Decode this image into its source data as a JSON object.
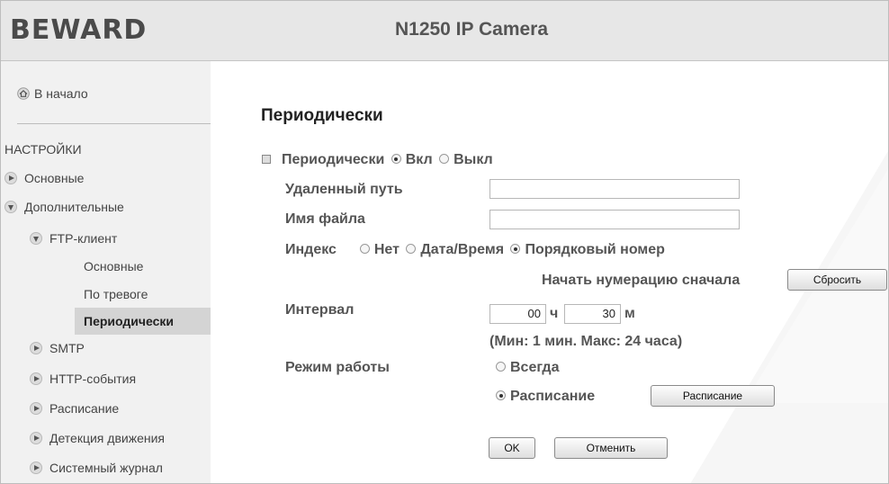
{
  "header": {
    "logo": "BEWARD",
    "camera_title": "N1250 IP Camera"
  },
  "sidebar": {
    "home_label": "В начало",
    "section_title": "НАСТРОЙКИ",
    "items": [
      {
        "label": "Основные",
        "state": "collapsed"
      },
      {
        "label": "Дополнительные",
        "state": "expanded"
      },
      {
        "label": "FTP-клиент",
        "state": "expanded"
      },
      {
        "label": "SMTP",
        "state": "collapsed"
      },
      {
        "label": "HTTP-события",
        "state": "collapsed"
      },
      {
        "label": "Расписание",
        "state": "collapsed"
      },
      {
        "label": "Детекция движения",
        "state": "collapsed"
      },
      {
        "label": "Системный журнал",
        "state": "collapsed"
      }
    ],
    "ftp_subitems": [
      {
        "label": "Основные",
        "active": false
      },
      {
        "label": "По тревоге",
        "active": false
      },
      {
        "label": "Периодически",
        "active": true
      }
    ]
  },
  "main": {
    "title": "Периодически",
    "periodic": {
      "label": "Периодически",
      "on_label": "Вкл",
      "off_label": "Выкл",
      "selected": "on"
    },
    "remote_path": {
      "label": "Удаленный путь",
      "value": ""
    },
    "file_name": {
      "label": "Имя файла",
      "value": ""
    },
    "index": {
      "label": "Индекс",
      "options": [
        "Нет",
        "Дата/Время",
        "Порядковый номер"
      ],
      "selected": "Порядковый номер"
    },
    "restart_numbering_label": "Начать нумерацию сначала",
    "reset_button": "Сбросить",
    "interval": {
      "label": "Интервал",
      "hours": "00",
      "hours_unit": "ч",
      "minutes": "30",
      "minutes_unit": "м"
    },
    "interval_hint": "(Мин: 1 мин. Макс: 24 часа)",
    "mode": {
      "label": "Режим работы",
      "always_label": "Всегда",
      "schedule_label": "Расписание",
      "selected": "schedule"
    },
    "schedule_button": "Расписание",
    "ok_button": "OK",
    "cancel_button": "Отменить"
  },
  "colors": {
    "header_bg": "#e7e7e7",
    "sidebar_bg": "#f1f1f1",
    "active_item_bg": "#d4d4d4",
    "label_text": "#555555"
  }
}
